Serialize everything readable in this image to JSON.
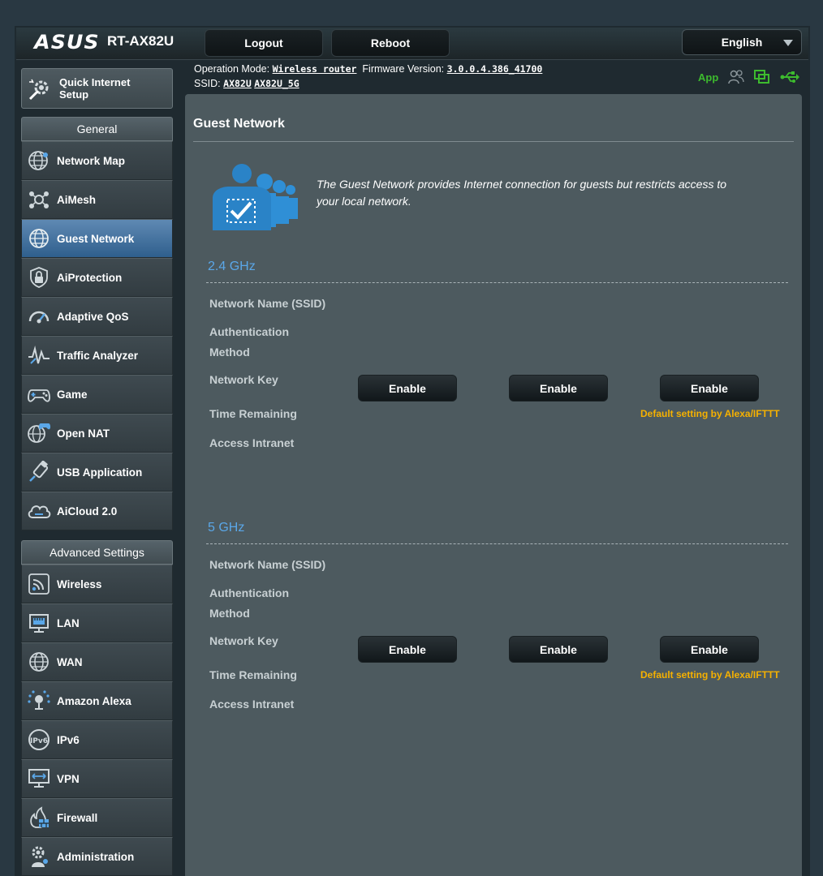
{
  "header": {
    "logo": "ASUS",
    "model": "RT-AX82U",
    "logout_label": "Logout",
    "reboot_label": "Reboot",
    "language": "English"
  },
  "info": {
    "op_mode_label": "Operation Mode:",
    "op_mode_value": "Wireless router",
    "firmware_label": "Firmware Version:",
    "firmware_value": "3.0.0.4.386_41700",
    "ssid_label": "SSID:",
    "ssid_24": "AX82U",
    "ssid_5": "AX82U_5G",
    "app_label": "App"
  },
  "sidebar": {
    "qis_label_1": "Quick Internet",
    "qis_label_2": "Setup",
    "general_title": "General",
    "general_items": [
      {
        "label": "Network Map",
        "icon": "globe-network-icon"
      },
      {
        "label": "AiMesh",
        "icon": "aimesh-icon"
      },
      {
        "label": "Guest Network",
        "icon": "globe-icon",
        "active": true
      },
      {
        "label": "AiProtection",
        "icon": "lock-icon"
      },
      {
        "label": "Adaptive QoS",
        "icon": "gauge-icon"
      },
      {
        "label": "Traffic Analyzer",
        "icon": "pulse-icon"
      },
      {
        "label": "Game",
        "icon": "gamepad-icon"
      },
      {
        "label": "Open NAT",
        "icon": "globe-gamepad-icon"
      },
      {
        "label": "USB Application",
        "icon": "usb-icon"
      },
      {
        "label": "AiCloud 2.0",
        "icon": "cloud-icon"
      }
    ],
    "advanced_title": "Advanced Settings",
    "advanced_items": [
      {
        "label": "Wireless",
        "icon": "wifi-icon"
      },
      {
        "label": "LAN",
        "icon": "lan-icon"
      },
      {
        "label": "WAN",
        "icon": "globe-icon"
      },
      {
        "label": "Amazon Alexa",
        "icon": "alexa-icon"
      },
      {
        "label": "IPv6",
        "icon": "ipv6-icon"
      },
      {
        "label": "VPN",
        "icon": "vpn-icon"
      },
      {
        "label": "Firewall",
        "icon": "fire-icon"
      },
      {
        "label": "Administration",
        "icon": "gear-person-icon"
      }
    ]
  },
  "main": {
    "title": "Guest Network",
    "description": "The Guest Network provides Internet connection for guests but restricts access to your local network.",
    "bands": [
      {
        "name": "2.4 GHz",
        "labels": [
          "Network Name (SSID)",
          "Authentication",
          "Method",
          "Network Key",
          "Time Remaining",
          "Access Intranet"
        ],
        "buttons": [
          "Enable",
          "Enable",
          "Enable"
        ],
        "alexa_note": "Default setting by Alexa/IFTTT"
      },
      {
        "name": "5 GHz",
        "labels": [
          "Network Name (SSID)",
          "Authentication",
          "Method",
          "Network Key",
          "Time Remaining",
          "Access Intranet"
        ],
        "buttons": [
          "Enable",
          "Enable",
          "Enable"
        ],
        "alexa_note": "Default setting by Alexa/IFTTT"
      }
    ]
  },
  "colors": {
    "accent_blue": "#5aa7e8",
    "alexa_note": "#f6b100",
    "status_green": "#3dbb2e",
    "active_menu": "#3e6d9b"
  }
}
